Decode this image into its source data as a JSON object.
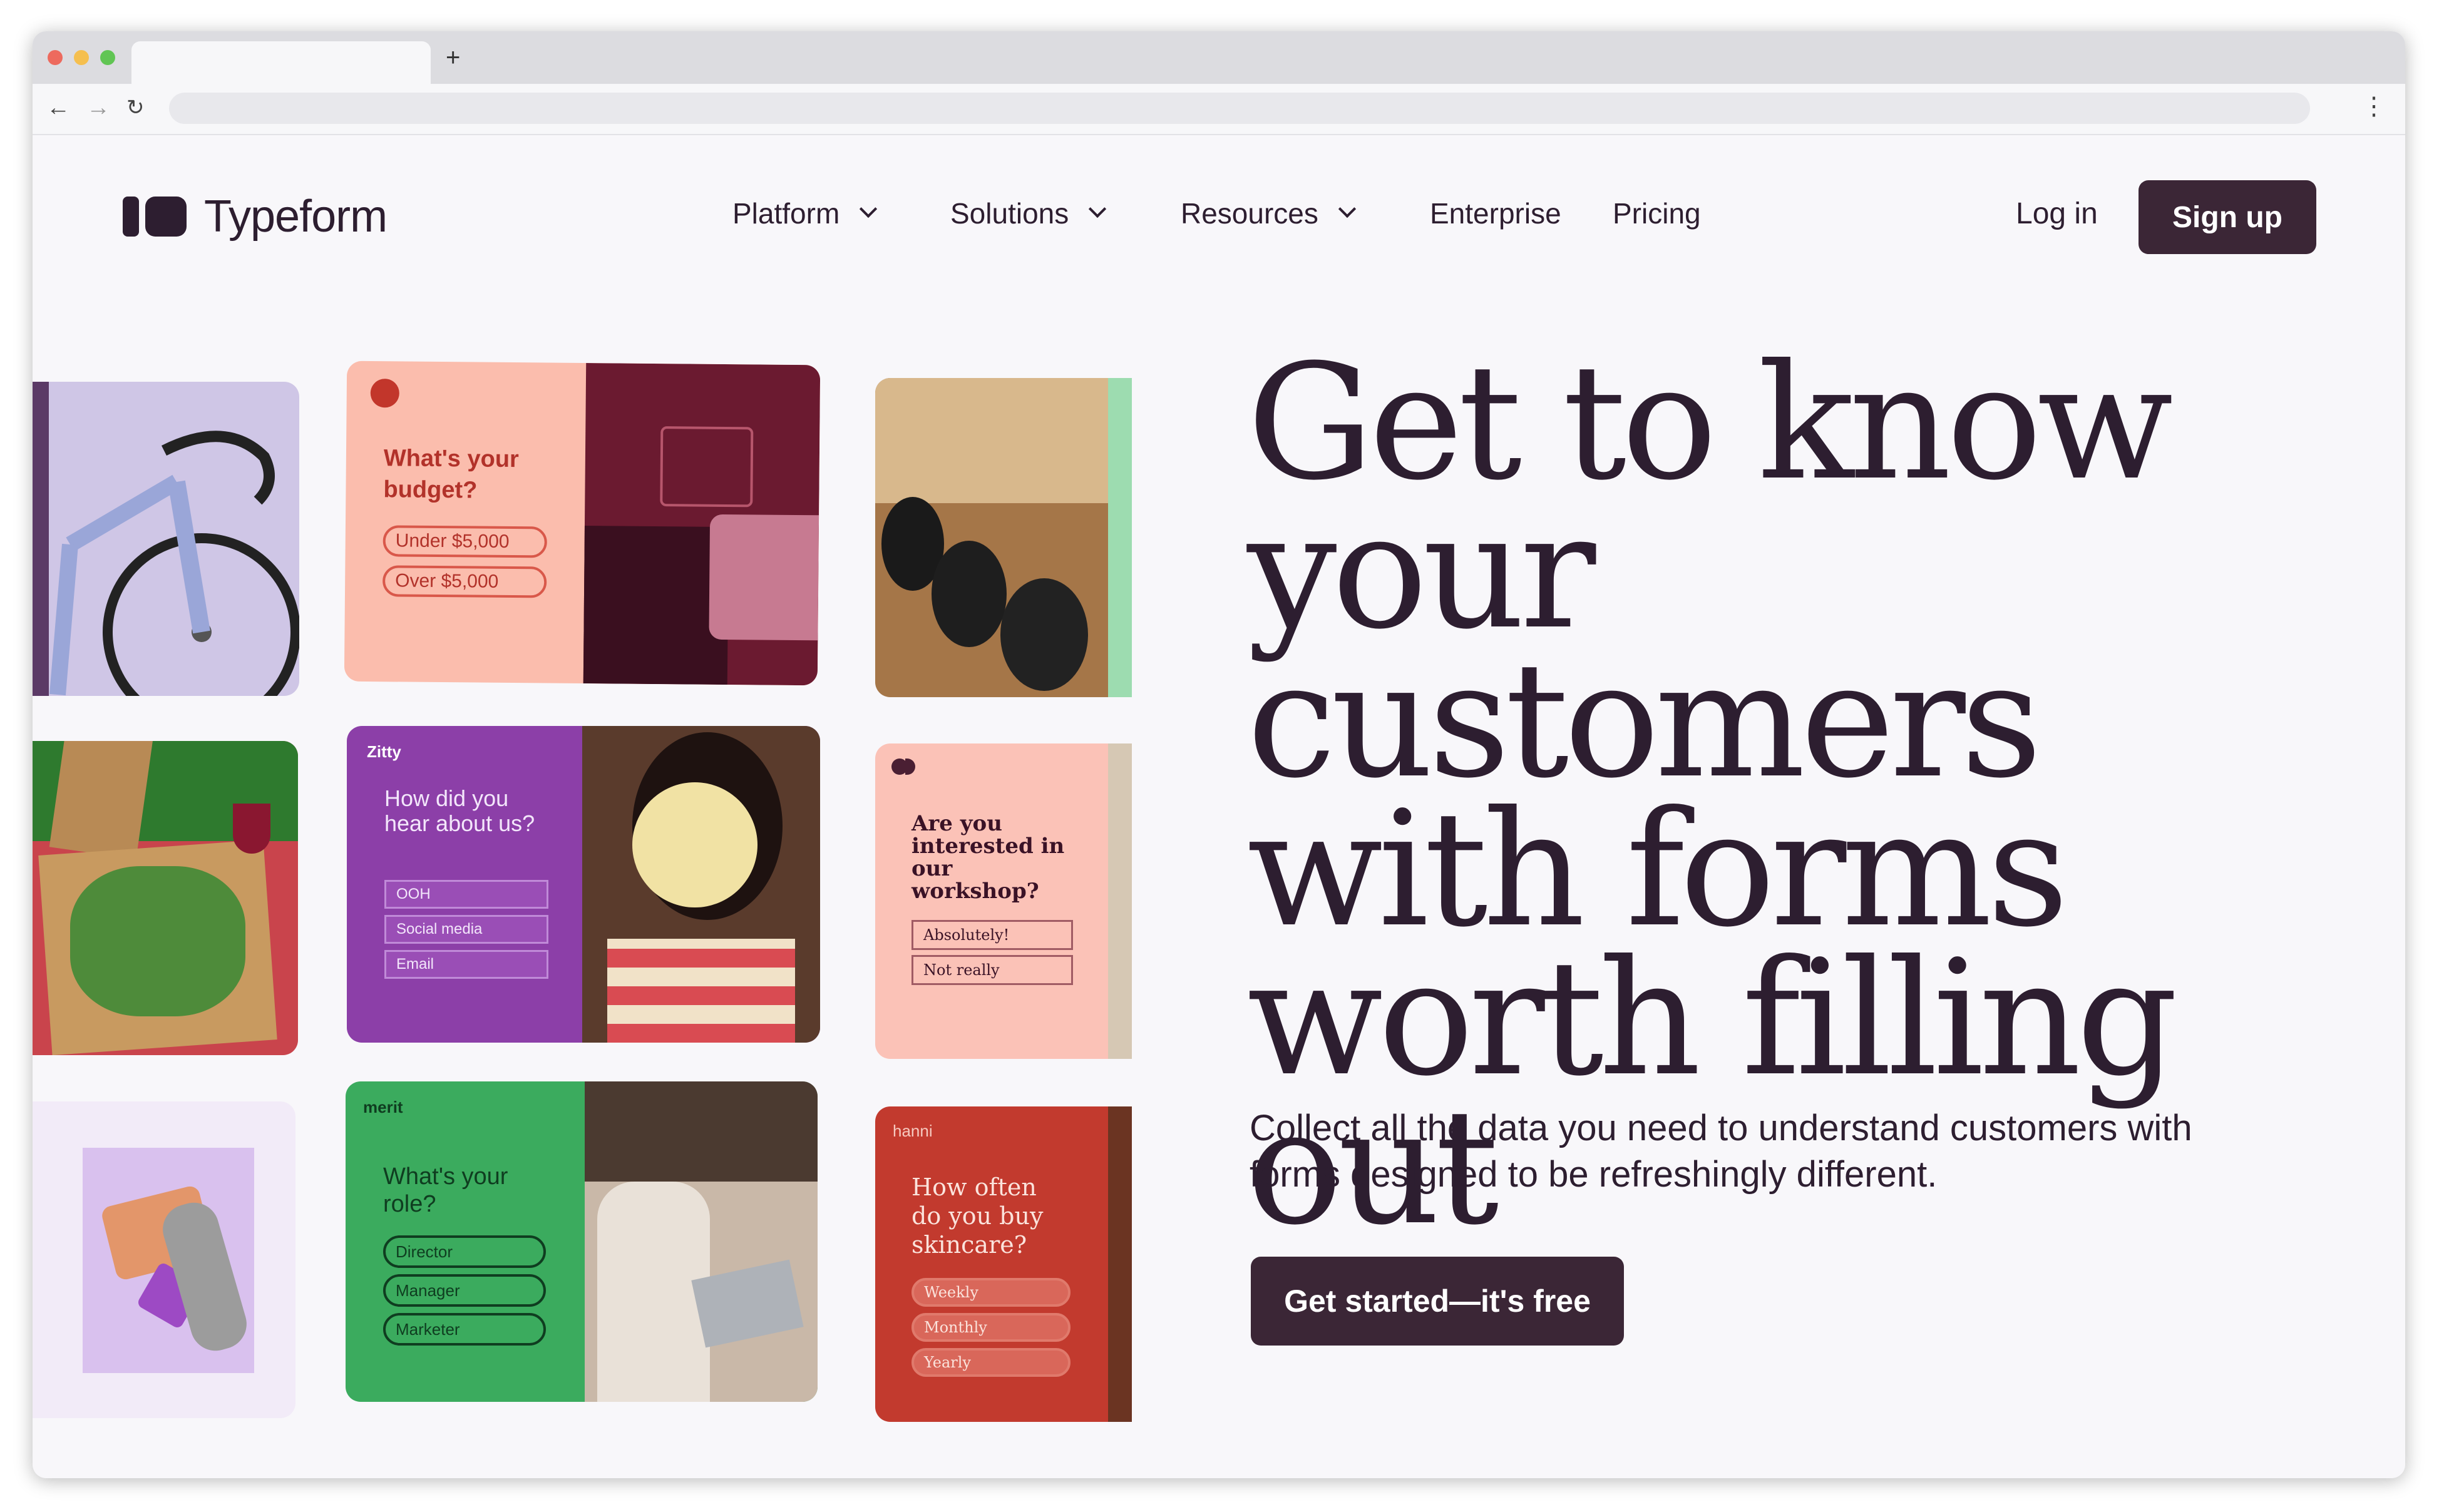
{
  "browser": {
    "new_tab_label": "+",
    "back_icon": "arrow-left-icon",
    "forward_icon": "arrow-right-icon",
    "reload_icon": "reload-icon",
    "menu_icon": "kebab-menu-icon",
    "colors": {
      "close": "#ed6a5e",
      "minimize": "#f5bf4f",
      "maximize": "#61c554"
    }
  },
  "header": {
    "logo_text": "Typeform",
    "nav": [
      {
        "label": "Platform",
        "has_dropdown": true
      },
      {
        "label": "Solutions",
        "has_dropdown": true
      },
      {
        "label": "Resources",
        "has_dropdown": true
      },
      {
        "label": "Enterprise",
        "has_dropdown": false
      },
      {
        "label": "Pricing",
        "has_dropdown": false
      }
    ],
    "login_label": "Log in",
    "signup_label": "Sign up"
  },
  "hero": {
    "headline_lines": [
      "Get to know",
      "your customers",
      "with forms",
      "worth filling out"
    ],
    "subtext": "Collect all the data you need to understand customers with forms designed to be refreshingly different.",
    "cta_label": "Get started—it's free",
    "colors": {
      "primary": "#3b2636",
      "text": "#2d1e30",
      "background": "#f8f7fa"
    }
  },
  "gallery": {
    "budget_card": {
      "question": "What's your budget?",
      "options": [
        "Under $5,000",
        "Over $5,000"
      ]
    },
    "zitty_card": {
      "brand": "Zitty",
      "question": "How did you hear about us?",
      "options": [
        "OOH",
        "Social media",
        "Email"
      ]
    },
    "workshop_card": {
      "question": "Are you interested in our workshop?",
      "options": [
        "Absolutely!",
        "Not really"
      ]
    },
    "merit_card": {
      "brand": "merit",
      "question": "What's your role?",
      "options": [
        "Director",
        "Manager",
        "Marketer"
      ]
    },
    "hanni_card": {
      "brand": "hanni",
      "question": "How often do you buy skincare?",
      "options": [
        "Weekly",
        "Monthly",
        "Yearly"
      ]
    }
  }
}
